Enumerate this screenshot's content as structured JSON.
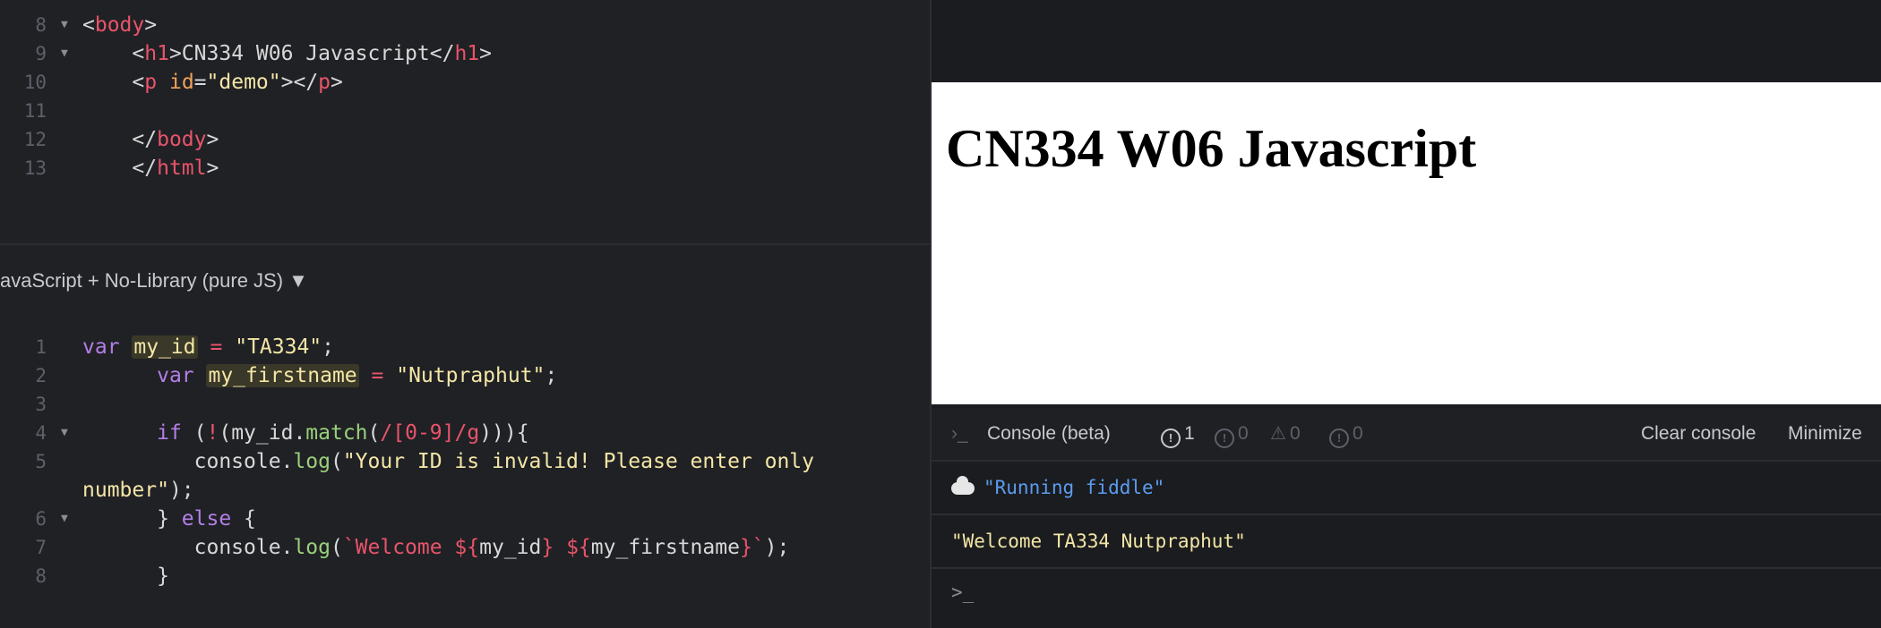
{
  "html_editor": {
    "lines": [
      {
        "num": "8",
        "fold": "▼",
        "tokens": [
          [
            "punc",
            "<"
          ],
          [
            "tag",
            "body"
          ],
          [
            "punc",
            ">"
          ]
        ]
      },
      {
        "num": "9",
        "fold": "▼",
        "tokens": [
          [
            "punc",
            "    <"
          ],
          [
            "tag",
            "h1"
          ],
          [
            "punc",
            ">CN334 W06 Javascript</"
          ],
          [
            "tag",
            "h1"
          ],
          [
            "punc",
            ">"
          ]
        ]
      },
      {
        "num": "10",
        "fold": "",
        "tokens": [
          [
            "punc",
            "    <"
          ],
          [
            "tag",
            "p"
          ],
          [
            "punc",
            " "
          ],
          [
            "attr",
            "id"
          ],
          [
            "punc",
            "="
          ],
          [
            "str",
            "\"demo\""
          ],
          [
            "punc",
            "></"
          ],
          [
            "tag",
            "p"
          ],
          [
            "punc",
            ">"
          ]
        ]
      },
      {
        "num": "11",
        "fold": "",
        "tokens": []
      },
      {
        "num": "12",
        "fold": "",
        "tokens": [
          [
            "punc",
            "    </"
          ],
          [
            "tag",
            "body"
          ],
          [
            "punc",
            ">"
          ]
        ]
      },
      {
        "num": "13",
        "fold": "",
        "tokens": [
          [
            "punc",
            "    </"
          ],
          [
            "tag",
            "html"
          ],
          [
            "punc",
            ">"
          ]
        ]
      }
    ]
  },
  "js_editor": {
    "header": "avaScript + No-Library (pure JS) ▼",
    "lines": [
      {
        "num": "1",
        "fold": "",
        "tokens": [
          [
            "kw",
            "var "
          ],
          [
            "var",
            "my_id"
          ],
          [
            "punc",
            " "
          ],
          [
            "op",
            "="
          ],
          [
            "punc",
            " "
          ],
          [
            "str",
            "\"TA334\""
          ],
          [
            "punc",
            ";"
          ]
        ]
      },
      {
        "num": "2",
        "fold": "",
        "tokens": [
          [
            "punc",
            "      "
          ],
          [
            "kw",
            "var "
          ],
          [
            "var",
            "my_firstname"
          ],
          [
            "punc",
            " "
          ],
          [
            "op",
            "="
          ],
          [
            "punc",
            " "
          ],
          [
            "str",
            "\"Nutpraphut\""
          ],
          [
            "punc",
            ";"
          ]
        ]
      },
      {
        "num": "3",
        "fold": "",
        "tokens": []
      },
      {
        "num": "4",
        "fold": "▼",
        "tokens": [
          [
            "punc",
            "      "
          ],
          [
            "kw",
            "if"
          ],
          [
            "punc",
            " ("
          ],
          [
            "op",
            "!"
          ],
          [
            "punc",
            "(my_id."
          ],
          [
            "fn",
            "match"
          ],
          [
            "punc",
            "("
          ],
          [
            "re",
            "/[0-9]/g"
          ],
          [
            "punc",
            ")))"
          ],
          [
            "punc",
            "{"
          ]
        ]
      },
      {
        "num": "5",
        "fold": "",
        "tokens": [
          [
            "punc",
            "         console."
          ],
          [
            "fn",
            "log"
          ],
          [
            "punc",
            "("
          ],
          [
            "str",
            "\"Your ID is invalid! Please enter only"
          ]
        ]
      },
      {
        "num": "",
        "fold": "",
        "tokens": [
          [
            "str",
            "number\""
          ],
          [
            "punc",
            ");"
          ]
        ]
      },
      {
        "num": "6",
        "fold": "▼",
        "tokens": [
          [
            "punc",
            "      } "
          ],
          [
            "kw",
            "else"
          ],
          [
            "punc",
            " {"
          ]
        ]
      },
      {
        "num": "7",
        "fold": "",
        "tokens": [
          [
            "punc",
            "         console."
          ],
          [
            "fn",
            "log"
          ],
          [
            "punc",
            "("
          ],
          [
            "tpl",
            "`Welcome ${"
          ],
          [
            "punc",
            "my_id"
          ],
          [
            "tpl",
            "} ${"
          ],
          [
            "punc",
            "my_firstname"
          ],
          [
            "tpl",
            "}`"
          ],
          [
            "punc",
            ");"
          ]
        ]
      },
      {
        "num": "8",
        "fold": "",
        "tokens": [
          [
            "punc",
            "      }"
          ]
        ]
      }
    ]
  },
  "preview": {
    "heading": "CN334 W06 Javascript"
  },
  "console": {
    "prompt_glyph": "›_",
    "title": "Console (beta)",
    "errors_count": "1",
    "warnings_count": "0",
    "alerts_count": "0",
    "info_count": "0",
    "clear_label": "Clear console",
    "minimize_label": "Minimize",
    "logs": [
      {
        "text": "\"Running fiddle\"",
        "color": "#5b9cf0",
        "icon": "cloud-icon"
      },
      {
        "text": "\"Welcome TA334 Nutpraphut\"",
        "color": "#f3e6a6",
        "icon": ""
      }
    ],
    "input_prompt": ">_"
  }
}
